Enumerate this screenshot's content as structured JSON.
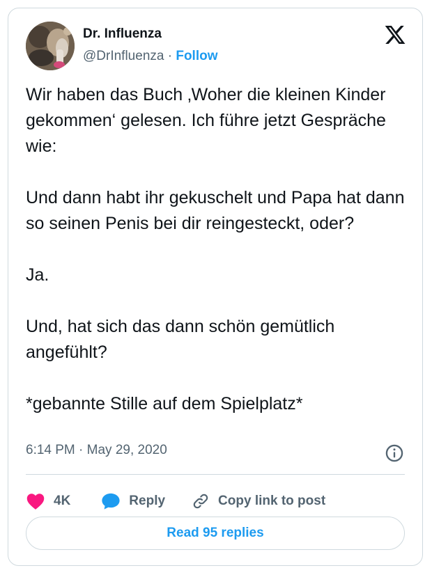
{
  "author": {
    "name": "Dr. Influenza",
    "handle": "@DrInfluenza",
    "separator": "·",
    "follow_label": "Follow"
  },
  "tweet": {
    "paragraphs": [
      "Wir haben das Buch ‚Woher die kleinen Kinder gekommen‘ gelesen. Ich führe jetzt Gespräche wie:",
      "Und dann habt ihr gekuschelt und Papa hat dann so seinen Penis bei dir reingesteckt, oder?",
      "Ja.",
      "Und, hat sich das dann schön gemütlich angefühlt?",
      "*gebannte Stille auf dem Spielplatz*"
    ],
    "timestamp": "6:14 PM · May 29, 2020"
  },
  "actions": {
    "like_count": "4K",
    "reply_label": "Reply",
    "copy_link_label": "Copy link to post"
  },
  "read_replies_label": "Read 95 replies",
  "icons": {
    "x_logo": "x-logo-icon",
    "like": "heart-icon",
    "reply": "speech-bubble-icon",
    "copy": "link-icon",
    "info": "info-icon"
  },
  "colors": {
    "accent": "#1d9bf0",
    "like": "#f91880",
    "text": "#0f1419",
    "muted": "#536471",
    "border": "#cfd9de"
  }
}
